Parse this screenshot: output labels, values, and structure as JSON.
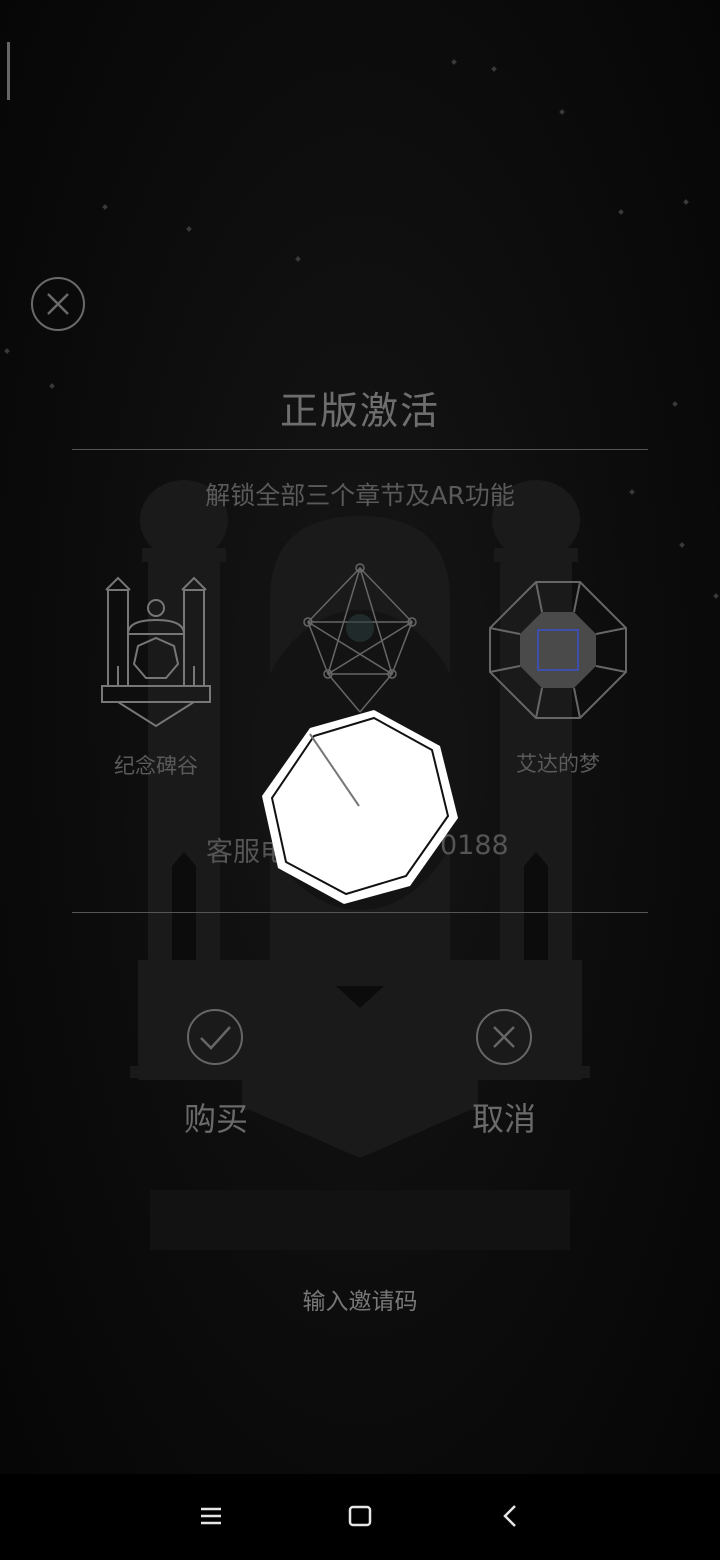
{
  "dialog": {
    "title": "正版激活",
    "subtitle": "解锁全部三个章节及AR功能",
    "chapters": [
      {
        "label": "纪念碑谷"
      },
      {
        "label": ""
      },
      {
        "label": "艾达的梦"
      }
    ],
    "phone_left": "客服电",
    "phone_right": "0188",
    "buy_label": "购买",
    "cancel_label": "取消",
    "invite_label": "输入邀请码"
  },
  "icons": {
    "close": "close-circle-icon",
    "confirm": "check-circle-icon",
    "cancel": "x-circle-icon",
    "loader": "octagon-loader-icon",
    "nav_menu": "menu-icon",
    "nav_home": "home-square-icon",
    "nav_back": "back-chevron-icon"
  },
  "colors": {
    "background": "#0c0c0c",
    "text_dim": "#6e6e6e",
    "accent_blue": "#3d4fa8",
    "loader_fill": "#ffffff"
  }
}
